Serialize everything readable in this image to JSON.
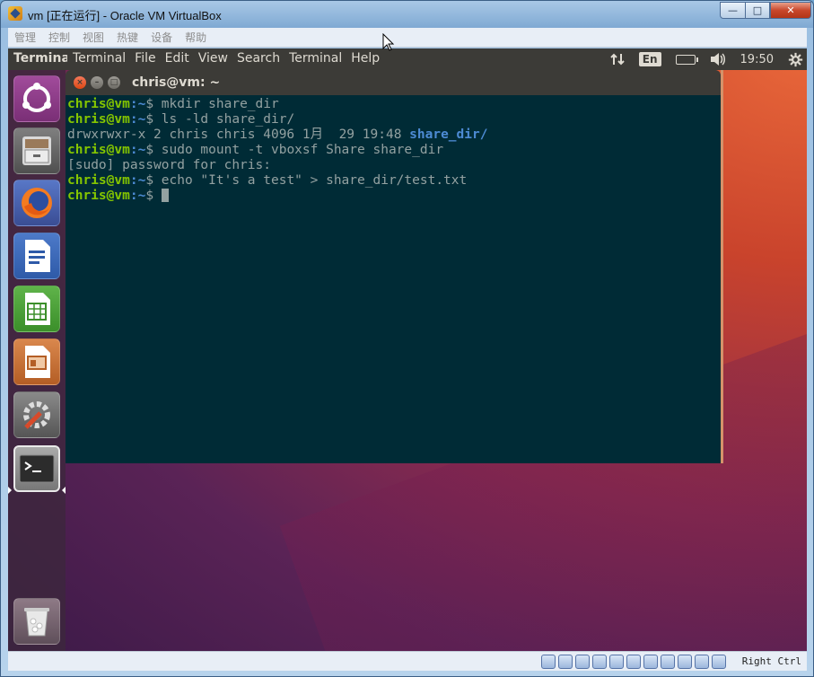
{
  "host": {
    "title": "vm [正在运行] - Oracle VM VirtualBox",
    "min_label": "—",
    "max_label": "□",
    "close_label": "✕"
  },
  "vbox_menu": [
    "管理",
    "控制",
    "视图",
    "热键",
    "设备",
    "帮助"
  ],
  "top_panel": {
    "app_title": "Terminal",
    "menu": [
      "Terminal",
      "File",
      "Edit",
      "View",
      "Search",
      "Terminal",
      "Help"
    ],
    "lang": "En",
    "time": "19:50"
  },
  "launcher": {
    "items": [
      "ubuntu-dash",
      "files",
      "firefox",
      "libreoffice-writer",
      "libreoffice-calc",
      "libreoffice-impress",
      "system-settings",
      "terminal",
      "trash"
    ]
  },
  "terminal": {
    "title": "chris@vm: ~",
    "user": "chris@vm",
    "path": ":~",
    "dollar": "$",
    "lines": [
      {
        "type": "prompt",
        "cmd": " mkdir share_dir"
      },
      {
        "type": "prompt",
        "cmd": " ls -ld share_dir/"
      },
      {
        "type": "output",
        "text": "drwxrwxr-x 2 chris chris 4096 1月  29 19:48 ",
        "dir": "share_dir/"
      },
      {
        "type": "prompt",
        "cmd": " sudo mount -t vboxsf Share share_dir"
      },
      {
        "type": "output",
        "text": "[sudo] password for chris:"
      },
      {
        "type": "prompt",
        "cmd": " echo \"It's a test\" > share_dir/test.txt"
      },
      {
        "type": "prompt",
        "cmd": " "
      }
    ]
  },
  "status": {
    "host_key": "Right Ctrl",
    "icons": [
      "hdd-icon",
      "optical-icon",
      "audio-icon",
      "network-icon",
      "usb-icon",
      "shared-folder-icon",
      "display-icon",
      "video-capture-icon",
      "guest-additions-icon",
      "mouse-integration-icon",
      "host-key-icon"
    ]
  }
}
